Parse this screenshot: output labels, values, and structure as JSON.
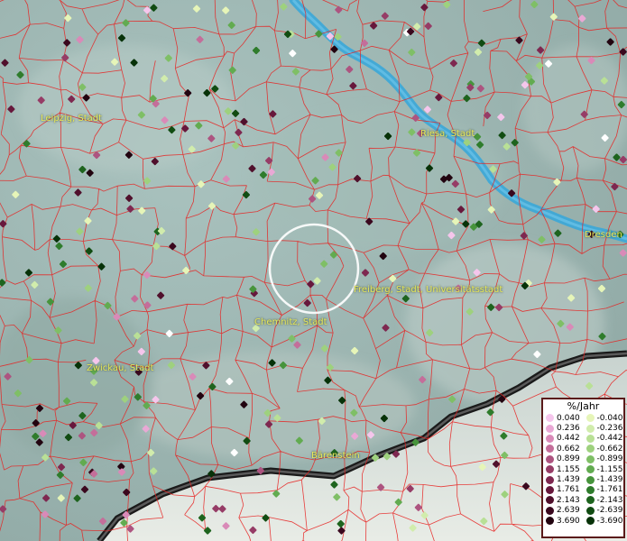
{
  "map": {
    "cities": [
      {
        "name": "Leipzig, Stadt"
      },
      {
        "name": "Riesa, Stadt"
      },
      {
        "name": "Dresden"
      },
      {
        "name": "Freiberg, Stadt, Universitätsstadt"
      },
      {
        "name": "Chemnitz, Stadt"
      },
      {
        "name": "Zwickau, Stadt"
      },
      {
        "name": "Bärenstein"
      }
    ]
  },
  "legend": {
    "title": "%/Jahr",
    "rows": [
      {
        "pos": "0.040",
        "neg": "-0.040",
        "pos_color": "#f5c6ec",
        "neg_color": "#e6f5b8"
      },
      {
        "pos": "0.236",
        "neg": "-0.236",
        "pos_color": "#e9a8d5",
        "neg_color": "#d1ecac"
      },
      {
        "pos": "0.442",
        "neg": "-0.442",
        "pos_color": "#d98ab8",
        "neg_color": "#b9e096"
      },
      {
        "pos": "0.662",
        "neg": "-0.662",
        "pos_color": "#c46e9a",
        "neg_color": "#9ed17e"
      },
      {
        "pos": "0.899",
        "neg": "-0.899",
        "pos_color": "#ad5480",
        "neg_color": "#7fbf66"
      },
      {
        "pos": "1.155",
        "neg": "-1.155",
        "pos_color": "#963c66",
        "neg_color": "#62ab50"
      },
      {
        "pos": "1.439",
        "neg": "-1.439",
        "pos_color": "#7e2850",
        "neg_color": "#47943c"
      },
      {
        "pos": "1.761",
        "neg": "-1.761",
        "pos_color": "#67183c",
        "neg_color": "#2f7c2c"
      },
      {
        "pos": "2.143",
        "neg": "-2.143",
        "pos_color": "#50102c",
        "neg_color": "#1e641e"
      },
      {
        "pos": "2.639",
        "neg": "-2.639",
        "pos_color": "#3a081e",
        "neg_color": "#114c12"
      },
      {
        "pos": "3.690",
        "neg": "-3.690",
        "pos_color": "#220410",
        "neg_color": "#073208"
      }
    ]
  },
  "colors": {
    "land": "#9fb8b4",
    "river": "#3aa7d8",
    "border": "#e8201e",
    "label": "#e8e85a",
    "highlight": "#ffffff"
  }
}
